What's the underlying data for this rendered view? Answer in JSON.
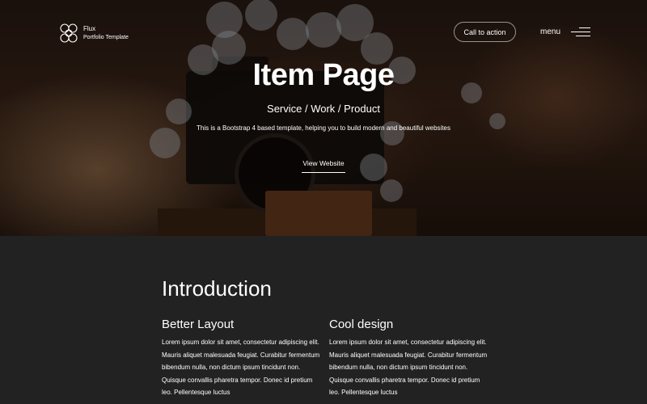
{
  "brand": {
    "name": "Flux",
    "tagline": "Portfolio Template"
  },
  "header": {
    "cta_label": "Call to action",
    "menu_label": "menu"
  },
  "hero": {
    "title": "Item Page",
    "subtitle": "Service / Work / Product",
    "description": "This is a Bootstrap 4 based template, helping you to build modern and beautiful websites",
    "link_label": "View Website"
  },
  "intro": {
    "title": "Introduction",
    "columns": [
      {
        "heading": "Better Layout",
        "text": "Lorem ipsum dolor sit amet, consectetur adipiscing elit. Mauris aliquet malesuada feugiat. Curabitur fermentum bibendum nulla, non dictum ipsum tincidunt non. Quisque convallis pharetra tempor. Donec id pretium leo. Pellentesque luctus"
      },
      {
        "heading": "Cool design",
        "text": "Lorem ipsum dolor sit amet, consectetur adipiscing elit. Mauris aliquet malesuada feugiat. Curabitur fermentum bibendum nulla, non dictum ipsum tincidunt non. Quisque convallis pharetra tempor. Donec id pretium leo. Pellentesque luctus"
      }
    ]
  },
  "colors": {
    "page_background": "#222222",
    "text": "#ffffff"
  },
  "icons": {
    "logo": "flux-logo-icon",
    "menu": "hamburger-menu-icon"
  }
}
